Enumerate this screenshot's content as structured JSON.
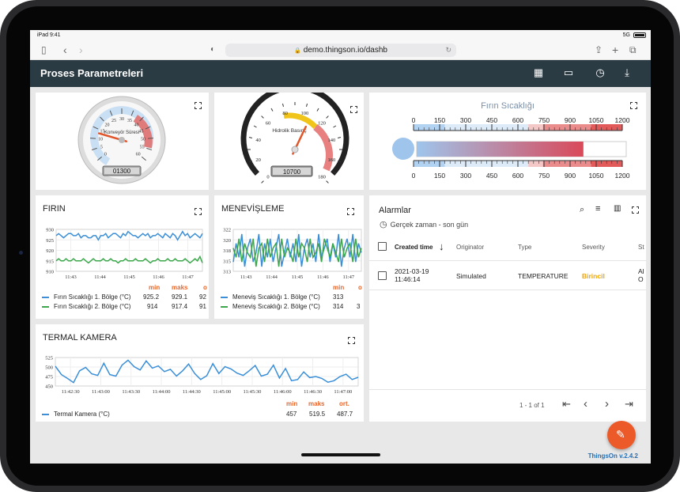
{
  "device": {
    "time": "iPad 9:41",
    "signal": "5G"
  },
  "browser": {
    "url": "demo.thingson.io/dashb"
  },
  "app": {
    "title": "Proses Parametreleri",
    "version": "ThingsOn v.2.4.2"
  },
  "gauge1": {
    "label": "Konveyör Süresi",
    "ticks": [
      "0",
      "5",
      "10",
      "15",
      "20",
      "25",
      "30",
      "35",
      "40",
      "45",
      "50",
      "55",
      "60"
    ],
    "value": 13,
    "readout": "01300"
  },
  "gauge2": {
    "label": "Hidrolik Basınç",
    "ticks": [
      "0",
      "20",
      "40",
      "60",
      "80",
      "100",
      "120",
      "140",
      "160",
      "180"
    ],
    "value": 107,
    "readout": "10700"
  },
  "thermo": {
    "title": "Fırın Sıcaklığı",
    "ticks": [
      "0",
      "150",
      "300",
      "450",
      "600",
      "750",
      "900",
      "1050",
      "1200"
    ],
    "value": 940,
    "max": 1200
  },
  "firin": {
    "title": "FIRIN",
    "chart_data": {
      "type": "line",
      "x_ticks": [
        "11:43",
        "11:44",
        "11:45",
        "11:46",
        "11:47"
      ],
      "ylim": [
        910,
        930
      ],
      "y_ticks": [
        "930",
        "925",
        "920",
        "915",
        "910"
      ],
      "series": [
        {
          "name": "Fırın Sıcaklığı 1. Bölge (°C)",
          "color": "#3a8fd8",
          "values": [
            927,
            928,
            927,
            926,
            927,
            928,
            928,
            927,
            927,
            928,
            926,
            927,
            927,
            926,
            926,
            927,
            927,
            925,
            927,
            927,
            928,
            926,
            927,
            928,
            928,
            927,
            926,
            928,
            927,
            929,
            928,
            927,
            927,
            926,
            927,
            928,
            927,
            928,
            926,
            927,
            927,
            928,
            927,
            926,
            928,
            927,
            926,
            928,
            927,
            925,
            927,
            929,
            927,
            928,
            926,
            927,
            928,
            927,
            926,
            928
          ]
        },
        {
          "name": "Fırın Sıcaklığı 2. Bölge (°C)",
          "color": "#3aa84a",
          "values": [
            915,
            916,
            915,
            915,
            916,
            915,
            915,
            916,
            915,
            915,
            915,
            916,
            915,
            914,
            915,
            916,
            915,
            915,
            915,
            916,
            915,
            915,
            916,
            915,
            915,
            914,
            915,
            915,
            916,
            915,
            915,
            915,
            916,
            915,
            915,
            915,
            916,
            915,
            914,
            915,
            915,
            916,
            915,
            915,
            915,
            916,
            915,
            915,
            916,
            915,
            915,
            915,
            916,
            915,
            914,
            915,
            916,
            915,
            917,
            914
          ]
        }
      ]
    },
    "legend_headers": [
      "min",
      "maks",
      "o"
    ],
    "legend_rows": [
      {
        "name": "Fırın Sıcaklığı 1. Bölge (°C)",
        "min": "925.2",
        "max": "929.1",
        "avg": "92"
      },
      {
        "name": "Fırın Sıcaklığı 2. Bölge (°C)",
        "min": "914",
        "max": "917.4",
        "avg": "91"
      }
    ]
  },
  "menevis": {
    "title": "MENEVİŞLEME",
    "chart_data": {
      "type": "line",
      "x_ticks": [
        "11:43",
        "11:44",
        "11:45",
        "11:46",
        "11:47"
      ],
      "ylim": [
        313,
        322
      ],
      "y_ticks": [
        "322",
        "320",
        "318",
        "315",
        "313"
      ],
      "series": [
        {
          "name": "Meneviş Sıcaklığı 1. Bölge (°C)",
          "color": "#3a8fd8",
          "values": [
            315,
            319,
            316,
            321,
            314,
            318,
            320,
            315,
            317,
            321,
            314,
            319,
            316,
            320,
            315,
            318,
            321,
            314,
            317,
            320,
            316,
            319,
            315,
            321,
            314,
            318,
            320,
            316,
            319,
            315,
            321,
            316,
            318,
            320,
            315,
            319,
            316,
            321,
            314,
            318,
            320,
            316,
            321,
            315,
            319,
            317
          ]
        },
        {
          "name": "Meneviş Sıcaklığı 2. Bölge (°C)",
          "color": "#3aa84a",
          "values": [
            318,
            316,
            320,
            315,
            319,
            317,
            316,
            320,
            314,
            318,
            319,
            315,
            320,
            316,
            318,
            319,
            314,
            320,
            316,
            318,
            317,
            315,
            320,
            316,
            319,
            318,
            315,
            320,
            316,
            317,
            319,
            315,
            320,
            318,
            316,
            319,
            317,
            315,
            320,
            316,
            318,
            319,
            315,
            320,
            316,
            318
          ]
        }
      ]
    },
    "legend_headers": [
      "min",
      "o"
    ],
    "legend_rows": [
      {
        "name": "Meneviş Sıcaklığı 1. Bölge (°C)",
        "min": "313",
        "avg": ""
      },
      {
        "name": "Meneviş Sıcaklığı 2. Bölge (°C)",
        "min": "314",
        "avg": "3"
      }
    ]
  },
  "termal": {
    "title": "TERMAL KAMERA",
    "chart_data": {
      "type": "line",
      "x_ticks": [
        "11:42:30",
        "11:43:00",
        "11:43:30",
        "11:44:00",
        "11:44:30",
        "11:45:00",
        "11:45:30",
        "11:46:00",
        "11:46:30",
        "11:47:00"
      ],
      "ylim": [
        450,
        525
      ],
      "y_ticks": [
        "525",
        "500",
        "475",
        "450"
      ],
      "series": [
        {
          "name": "Termal Kamera (°C)",
          "color": "#3a8fd8",
          "values": [
            502,
            480,
            470,
            459,
            490,
            499,
            482,
            478,
            510,
            480,
            476,
            505,
            518,
            501,
            492,
            516,
            497,
            503,
            488,
            494,
            476,
            490,
            508,
            483,
            467,
            477,
            509,
            483,
            501,
            495,
            484,
            478,
            490,
            504,
            476,
            481,
            505,
            471,
            496,
            464,
            467,
            487,
            472,
            475,
            470,
            460,
            464,
            475,
            481,
            467,
            473
          ]
        }
      ]
    },
    "legend_headers": [
      "min",
      "maks",
      "ort."
    ],
    "legend_rows": [
      {
        "name": "Termal Kamera (°C)",
        "min": "457",
        "max": "519.5",
        "avg": "487.7"
      }
    ]
  },
  "alarms": {
    "title": "Alarmlar",
    "timewindow": "Gerçek zaman - son gün",
    "columns": [
      "Created time",
      "Originator",
      "Type",
      "Severity",
      "St"
    ],
    "rows": [
      {
        "date": "2021-03-19",
        "time": "11:46:14",
        "originator": "Simulated",
        "type": "TEMPERATURE",
        "severity": "Birincil",
        "status_a": "Al",
        "status_b": "O"
      }
    ],
    "pagination": "1 - 1 of 1",
    "severity_color": "#f0a500"
  }
}
